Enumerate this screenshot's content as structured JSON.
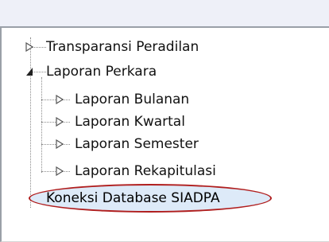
{
  "tree": {
    "items": [
      {
        "label": "Transparansi Peradilan",
        "state": "collapsed"
      },
      {
        "label": "Laporan Perkara",
        "state": "expanded"
      },
      {
        "label": "Laporan Bulanan",
        "state": "collapsed"
      },
      {
        "label": "Laporan Kwartal",
        "state": "collapsed"
      },
      {
        "label": "Laporan Semester",
        "state": "collapsed"
      },
      {
        "label": "Laporan Rekapitulasi",
        "state": "collapsed"
      },
      {
        "label": "Koneksi Database SIADPA",
        "state": "leaf",
        "highlighted": true
      }
    ]
  },
  "colors": {
    "highlight_ring": "#b01e1e",
    "highlight_fill": "#ddeaf8",
    "tree_line": "#8a8a8a"
  }
}
